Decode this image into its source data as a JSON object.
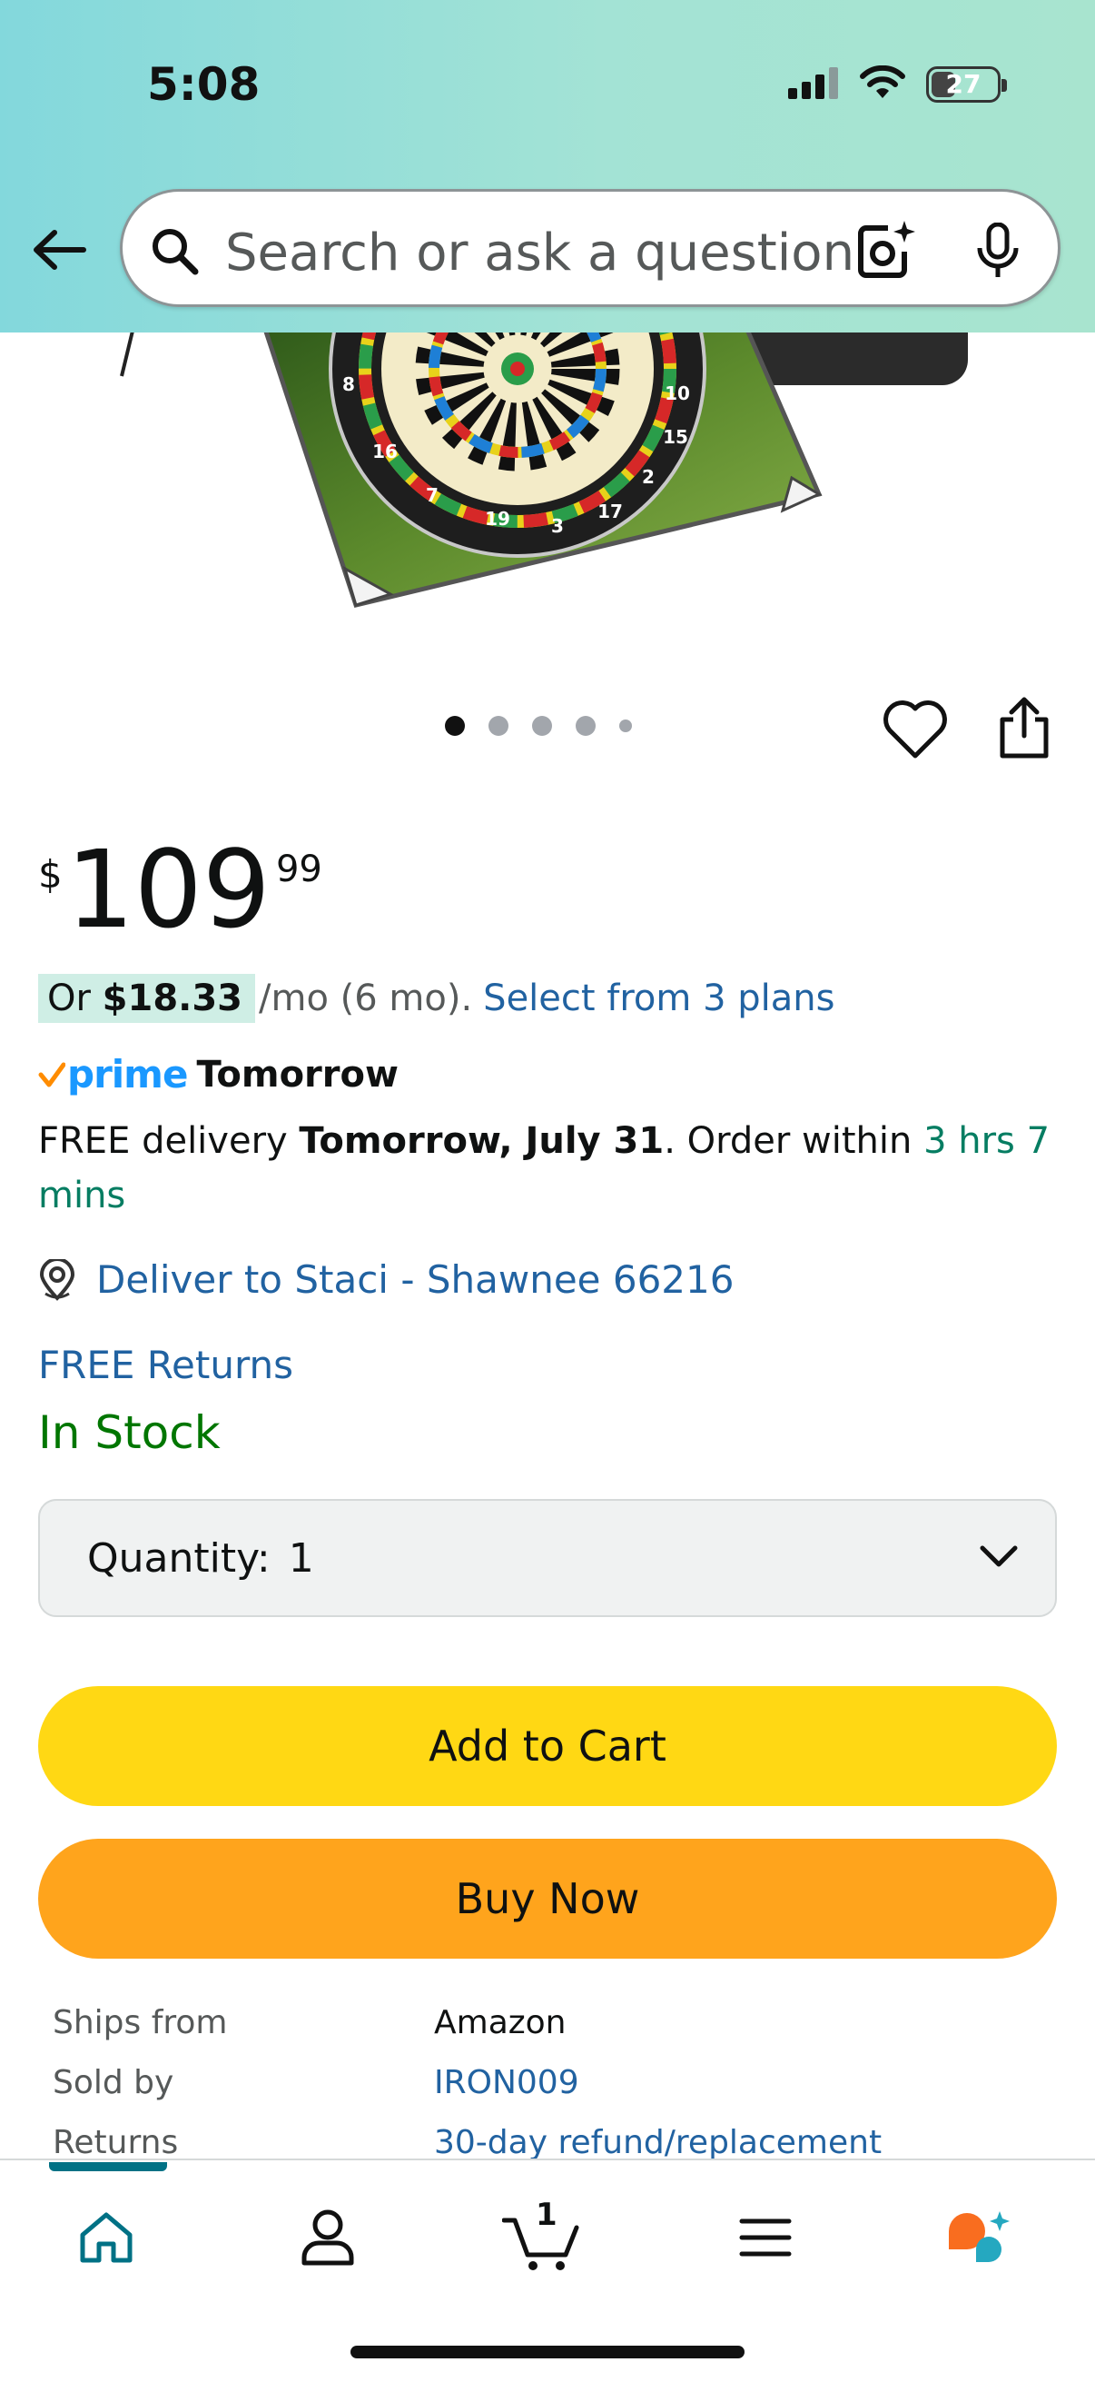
{
  "status_bar": {
    "time": "5:08",
    "battery": "27"
  },
  "search": {
    "placeholder": "Search or ask a question"
  },
  "carousel": {
    "dot_count": 5,
    "active_index": 0
  },
  "price": {
    "symbol": "$",
    "whole": "109",
    "fraction": "99"
  },
  "installment": {
    "prefix": "Or ",
    "amount": "$18.33",
    "term": "/mo (6 mo).",
    "link": "Select from 3 plans"
  },
  "prime": {
    "logo": "prime",
    "label": "Tomorrow"
  },
  "delivery": {
    "prefix": "FREE delivery ",
    "date": "Tomorrow, July 31",
    "middle": ". Order within ",
    "countdown": "3 hrs 7 mins"
  },
  "location": {
    "text": "Deliver to Staci - Shawnee 66216"
  },
  "returns": {
    "text": "FREE Returns"
  },
  "stock": {
    "text": "In Stock"
  },
  "quantity": {
    "label": "Quantity:",
    "value": "1"
  },
  "buttons": {
    "add_to_cart": "Add to Cart",
    "buy_now": "Buy Now"
  },
  "info": {
    "ships_from_label": "Ships from",
    "ships_from_value": "Amazon",
    "sold_by_label": "Sold by",
    "sold_by_value": "IRON009",
    "returns_label": "Returns",
    "returns_value": "30-day refund/replacement"
  },
  "dartboard_numbers": [
    "8",
    "16",
    "7",
    "19",
    "3",
    "17",
    "2",
    "15",
    "10"
  ],
  "bottom_nav": {
    "cart_count": "1"
  },
  "colors": {
    "accent_teal": "#007185",
    "link_blue": "#2162a1",
    "prime_blue": "#1a98ff",
    "prime_check": "#ff8c00",
    "in_stock_green": "#007600",
    "countdown_green": "#067d62",
    "add_to_cart_yellow": "#ffd814",
    "buy_now_orange": "#ffa41c",
    "rufus_orange": "#f96d1f",
    "rufus_teal": "#25a8c0"
  }
}
